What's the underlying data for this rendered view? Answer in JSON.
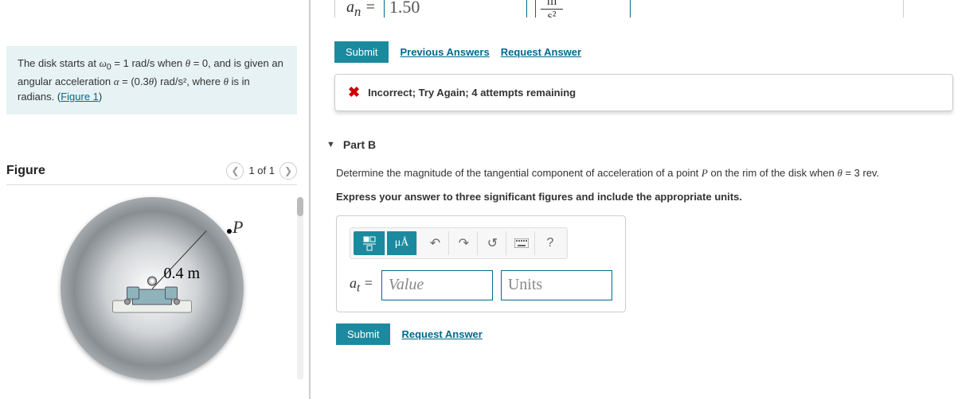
{
  "problem": {
    "text_parts": {
      "p1": "The disk starts at ",
      "omega0": "ω",
      "sub0": "0",
      "p2": " = 1 rad/s when ",
      "theta": "θ",
      "p3": " = 0, and is given an angular acceleration ",
      "alpha": "α",
      "p4": " = (0.3",
      "theta2": "θ",
      "p5": ") rad/s², where ",
      "theta3": "θ",
      "p6": " is in radians. (",
      "fig_link": "Figure 1",
      "p7": ")"
    }
  },
  "figure": {
    "title": "Figure",
    "pager": "1 of 1",
    "P_label": "P",
    "radius_label": "0.4 m"
  },
  "partA": {
    "var_label": "aₙ =",
    "entered_value": "1.50",
    "units_display_num": "m",
    "units_display_den": "s²",
    "submit": "Submit",
    "prev_link": "Previous Answers",
    "req_link": "Request Answer",
    "feedback": "Incorrect; Try Again; 4 attempts remaining"
  },
  "partB": {
    "header": "Part B",
    "question_prefix": "Determine the magnitude of the tangential component of acceleration of a point ",
    "question_P": "P",
    "question_mid": " on the rim of the disk when ",
    "question_theta": "θ",
    "question_val": " = 3 rev.",
    "instruction": "Express your answer to three significant figures and include the appropriate units.",
    "var_label": "aₜ =",
    "value_placeholder": "Value",
    "units_placeholder": "Units",
    "toolbar_mu": "μÅ",
    "submit": "Submit",
    "req_link": "Request Answer"
  }
}
